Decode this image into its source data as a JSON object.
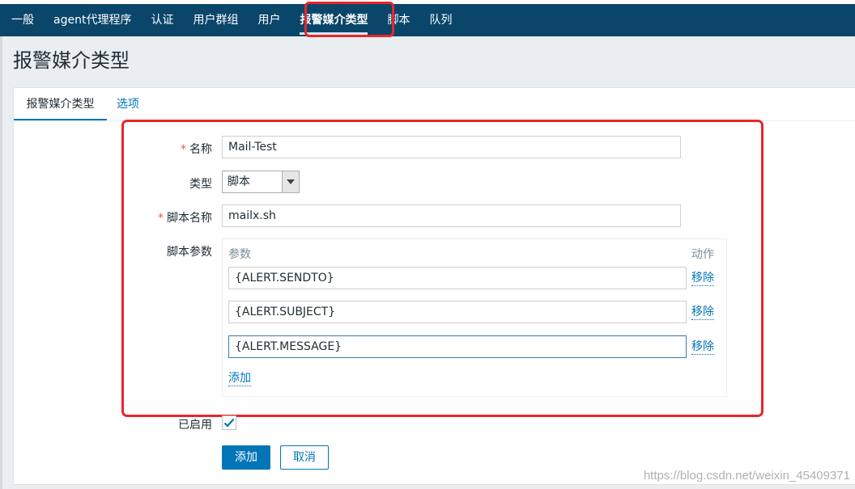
{
  "nav": {
    "items": [
      {
        "label": "一般",
        "active": false
      },
      {
        "label": "agent代理程序",
        "active": false
      },
      {
        "label": "认证",
        "active": false
      },
      {
        "label": "用户群组",
        "active": false
      },
      {
        "label": "用户",
        "active": false
      },
      {
        "label": "报警媒介类型",
        "active": true
      },
      {
        "label": "脚本",
        "active": false
      },
      {
        "label": "队列",
        "active": false
      }
    ]
  },
  "page": {
    "title": "报警媒介类型"
  },
  "tabs": [
    {
      "label": "报警媒介类型",
      "active": true
    },
    {
      "label": "选项",
      "active": false
    }
  ],
  "form": {
    "name": {
      "label": "名称",
      "required_mark": "*",
      "value": "Mail-Test"
    },
    "type": {
      "label": "类型",
      "value": "脚本"
    },
    "script_name": {
      "label": "脚本名称",
      "required_mark": "*",
      "value": "mailx.sh"
    },
    "script_params": {
      "label": "脚本参数",
      "col_param": "参数",
      "col_action": "动作",
      "rows": [
        {
          "value": "{ALERT.SENDTO}",
          "action": "移除"
        },
        {
          "value": "{ALERT.SUBJECT}",
          "action": "移除"
        },
        {
          "value": "{ALERT.MESSAGE}",
          "action": "移除"
        }
      ],
      "add_label": "添加"
    },
    "enabled": {
      "label": "已启用",
      "checked": true
    },
    "submit_label": "添加",
    "cancel_label": "取消"
  },
  "watermark": "https://blog.csdn.net/weixin_45409371",
  "colors": {
    "nav_bg": "#0a466a",
    "accent": "#0275b8",
    "annotation": "#e8262a",
    "required": "#e45959"
  }
}
